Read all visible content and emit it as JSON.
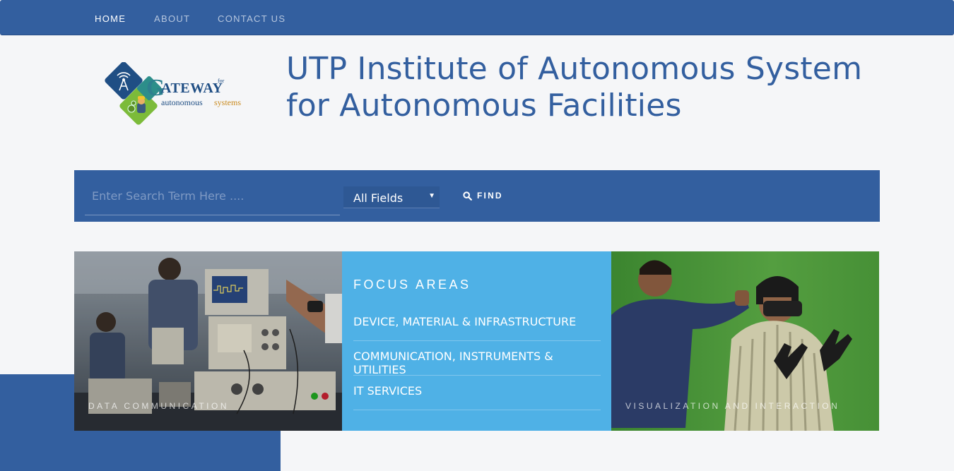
{
  "nav": {
    "items": [
      {
        "label": "HOME",
        "active": true
      },
      {
        "label": "ABOUT",
        "active": false
      },
      {
        "label": "CONTACT US",
        "active": false
      }
    ]
  },
  "logo": {
    "text_main": "ATEWAY",
    "text_letter": "G",
    "text_for": "for",
    "text_line2a": "autonomous",
    "text_line2b": "systems"
  },
  "header": {
    "title_line1": "UTP Institute of Autonomous System",
    "title_line2": "for Autonomous Facilities"
  },
  "search": {
    "placeholder": "Enter Search Term Here ....",
    "select_value": "All Fields",
    "button_label": "FIND"
  },
  "panels": {
    "left_caption": "DATA COMMUNICATION",
    "right_caption": "VISUALIZATION AND INTERACTION",
    "focus_title": "FOCUS AREAS",
    "focus_items": [
      {
        "label": "DEVICE, MATERIAL & INFRASTRUCTURE"
      },
      {
        "label": "COMMUNICATION, INSTRUMENTS & UTILITIES"
      },
      {
        "label": "IT SERVICES"
      }
    ]
  },
  "colors": {
    "primary": "#335f9f",
    "focus_bg": "#4fb1e6",
    "page_bg": "#f5f6f8"
  }
}
